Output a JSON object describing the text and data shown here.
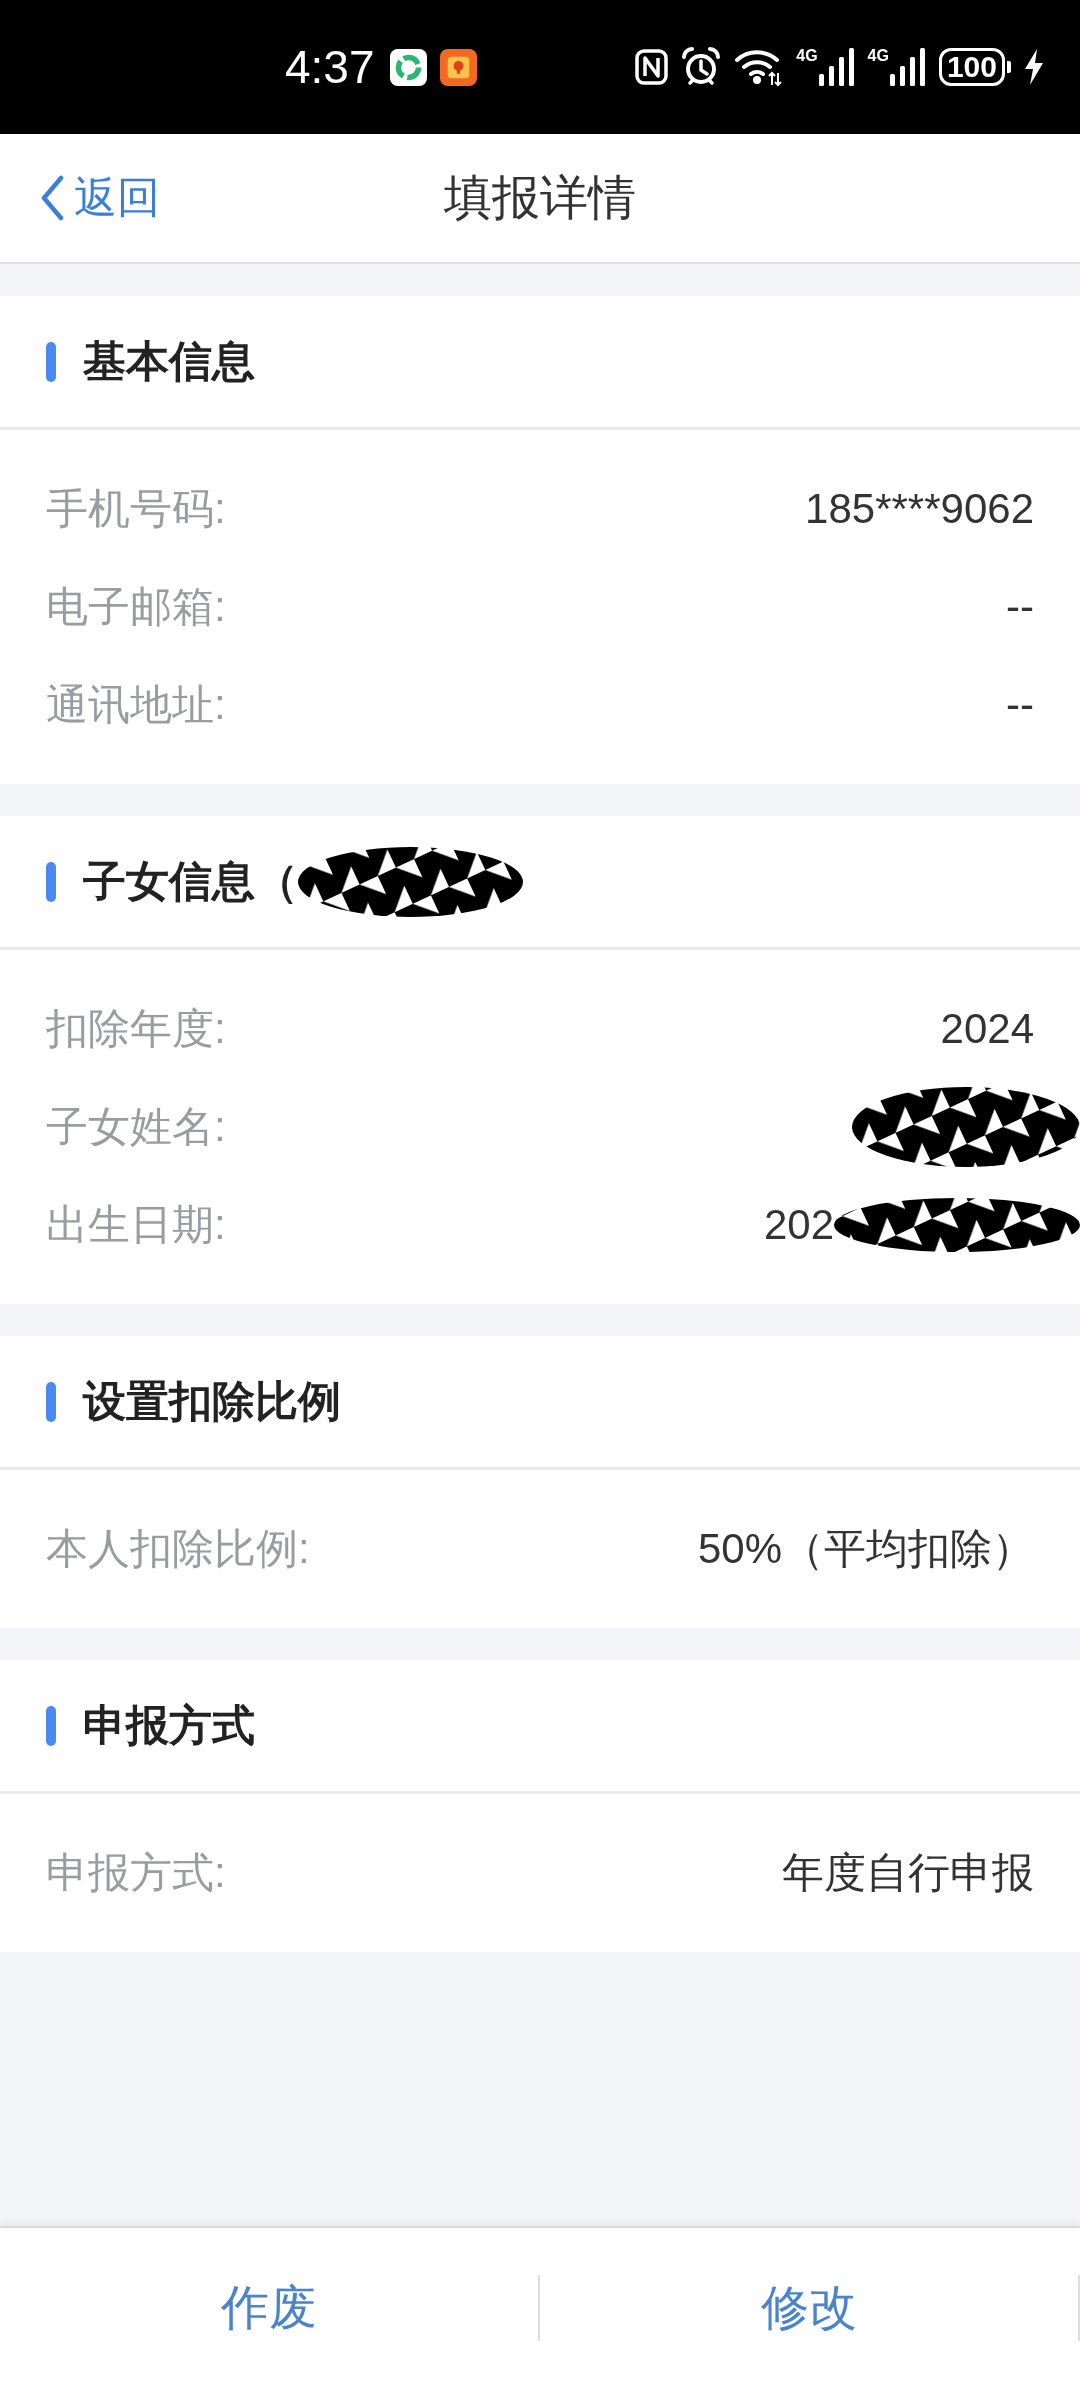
{
  "status_bar": {
    "time": "4:37",
    "networks": [
      {
        "label": "4G"
      },
      {
        "label": "4G"
      }
    ],
    "battery": "100",
    "charging": true
  },
  "header": {
    "back": "返回",
    "title": "填报详情"
  },
  "sections": [
    {
      "title": "基本信息",
      "redacted": false,
      "rows": [
        {
          "label": "手机号码:",
          "value": "185****9062",
          "redacted": false
        },
        {
          "label": "电子邮箱:",
          "value": "--",
          "redacted": false
        },
        {
          "label": "通讯地址:",
          "value": "--",
          "redacted": false
        }
      ]
    },
    {
      "title": "子女信息（",
      "redacted": true,
      "rows": [
        {
          "label": "扣除年度:",
          "value": "2024",
          "redacted": false
        },
        {
          "label": "子女姓名:",
          "redacted": true
        },
        {
          "label": "出生日期:",
          "value": "202",
          "redacted": true
        }
      ]
    },
    {
      "title": "设置扣除比例",
      "redacted": false,
      "rows": [
        {
          "label": "本人扣除比例:",
          "value": "50%（平均扣除）",
          "redacted": false
        }
      ]
    },
    {
      "title": "申报方式",
      "redacted": false,
      "rows": [
        {
          "label": "申报方式:",
          "value": "年度自行申报",
          "redacted": false
        }
      ]
    }
  ],
  "actions": [
    "作废",
    "修改"
  ]
}
